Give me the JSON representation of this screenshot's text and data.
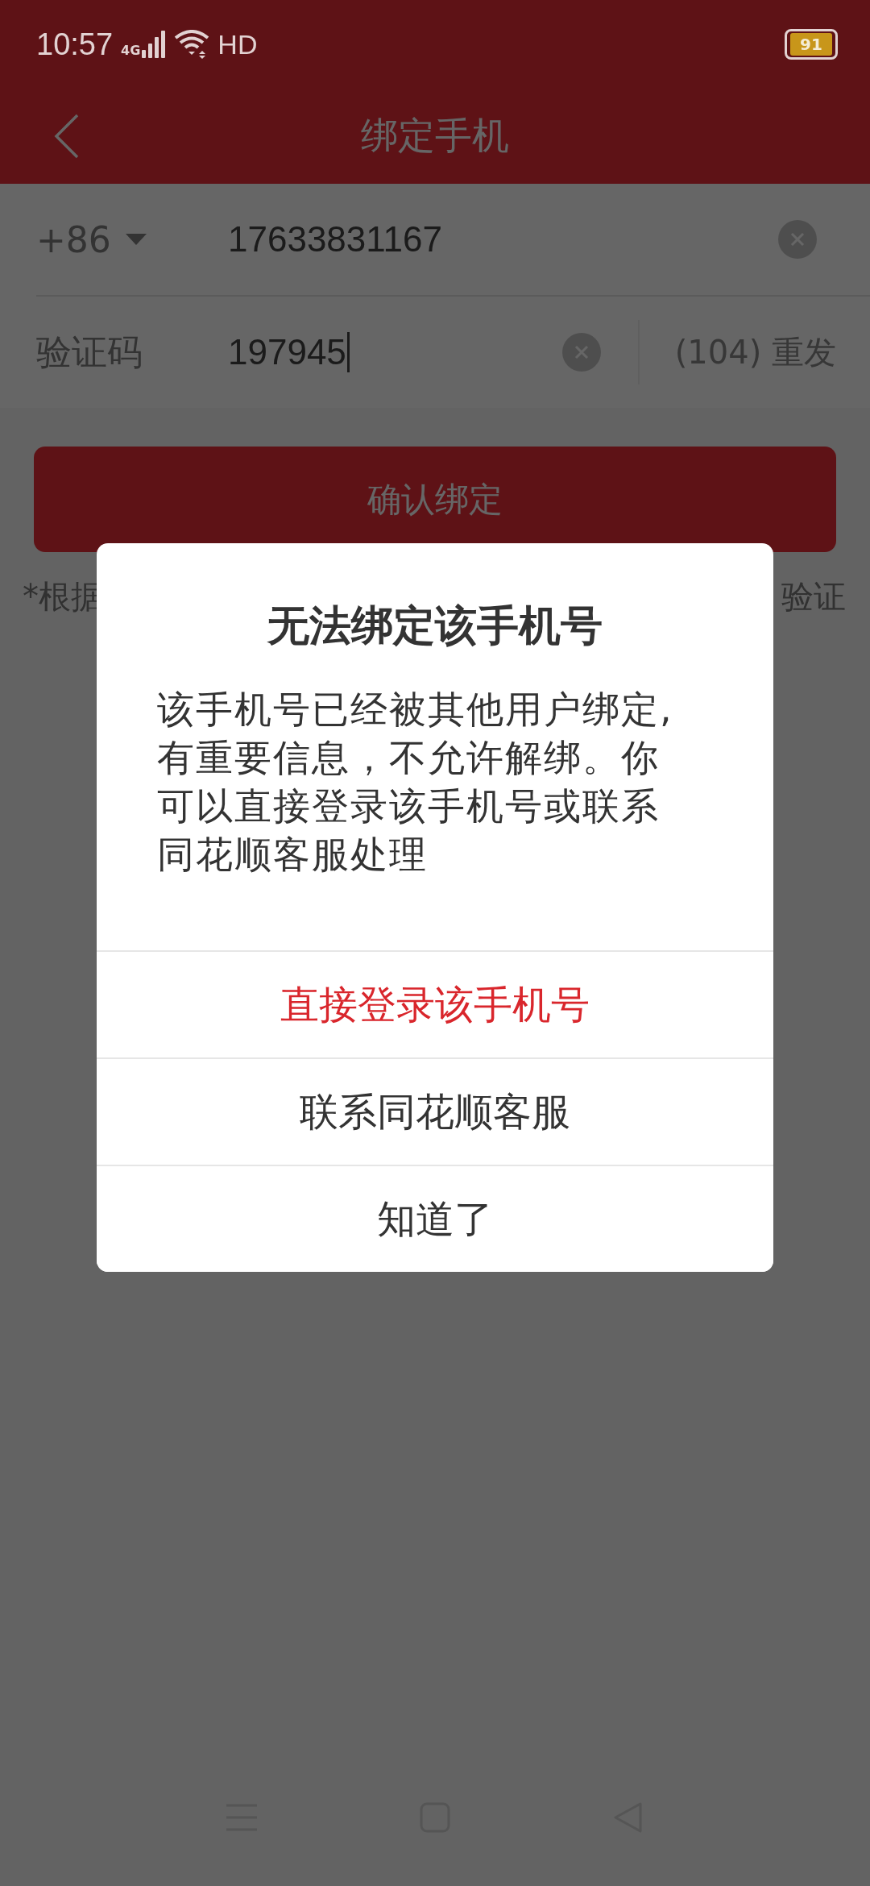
{
  "status_bar": {
    "time": "10:57",
    "network": "4G",
    "hd": "HD",
    "battery": "91"
  },
  "header": {
    "title": "绑定手机"
  },
  "phone": {
    "country_code": "+86",
    "value": "17633831167"
  },
  "code": {
    "label": "验证码",
    "value": "197945",
    "resend": "(104) 重发"
  },
  "confirm_button": "确认绑定",
  "hint": {
    "left": "*根据",
    "right": "验证"
  },
  "dialog": {
    "title": "无法绑定该手机号",
    "message": "该手机号已经被其他用户绑定,有重要信息，不允许解绑。你可以直接登录该手机号或联系同花顺客服处理",
    "actions": [
      {
        "label": "直接登录该手机号",
        "kind": "primary"
      },
      {
        "label": "联系同花顺客服",
        "kind": "normal"
      },
      {
        "label": "知道了",
        "kind": "normal"
      }
    ]
  }
}
